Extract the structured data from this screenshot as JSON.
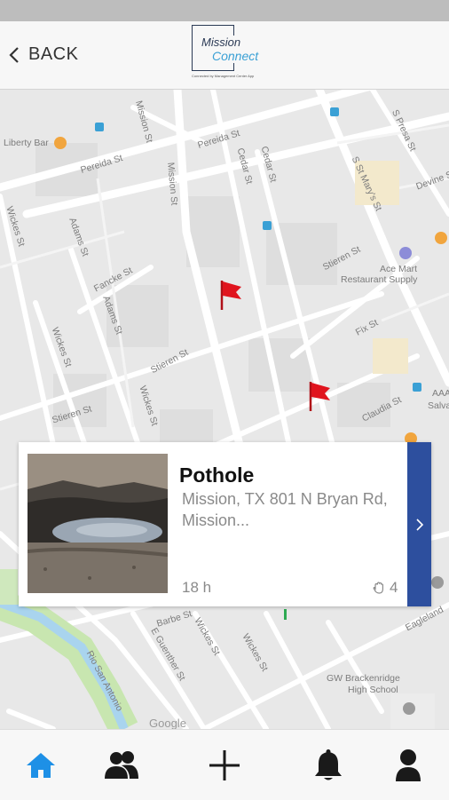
{
  "header": {
    "back_label": "BACK",
    "logo": {
      "line1": "Mission",
      "line2": "Connect",
      "tagline": "Connected by Management Center App"
    }
  },
  "map": {
    "labels": {
      "liberty_bar": "Liberty Bar",
      "pereida": "Pereida St",
      "pereida2": "Pereida St",
      "mission_top": "Mission St",
      "mission_mid": "Mission St",
      "cedar": "Cedar St",
      "cedar2": "Cedar St",
      "adams": "Adams St",
      "adams2": "Adams St",
      "wickes": "Wickes St",
      "wickes2": "Wickes St",
      "wickes3": "Wickes St",
      "wickes4": "Wickes St",
      "wickes5": "Wickes St",
      "fancke": "Fancke St",
      "stieren": "Stieren St",
      "stieren2": "Stieren St",
      "stieren3": "Stieren St",
      "fix": "Fix St",
      "claudia": "Claudia St",
      "st_marys": "S St Mary's St",
      "s_presa": "S Presa St",
      "devine": "Devine St",
      "ace_mart": "Ace Mart",
      "restaurant_supply": "Restaurant Supply",
      "barbe": "Barbe St",
      "e_guenther": "E Guenther St",
      "river": "Rio San Antonio",
      "gw_school": "GW Brackenridge",
      "high_school": "High School",
      "aaa": "AAA",
      "salva": "Salva",
      "eagleland": "Eagleland",
      "google": "Google"
    }
  },
  "report_card": {
    "title": "Pothole",
    "address": "Mission, TX 801 N Bryan Rd, Mission...",
    "age": "18 h",
    "votes": "4"
  },
  "bottom_nav": {
    "items": [
      {
        "name": "home",
        "icon": "home-icon",
        "active": true
      },
      {
        "name": "community",
        "icon": "people-icon",
        "active": false
      },
      {
        "name": "add",
        "icon": "plus-icon",
        "active": false
      },
      {
        "name": "notifications",
        "icon": "bell-icon",
        "active": false
      },
      {
        "name": "profile",
        "icon": "person-icon",
        "active": false
      }
    ]
  },
  "colors": {
    "accent_blue": "#2d4f9e",
    "active_icon": "#1e90e6",
    "flag_red": "#e0141e"
  }
}
